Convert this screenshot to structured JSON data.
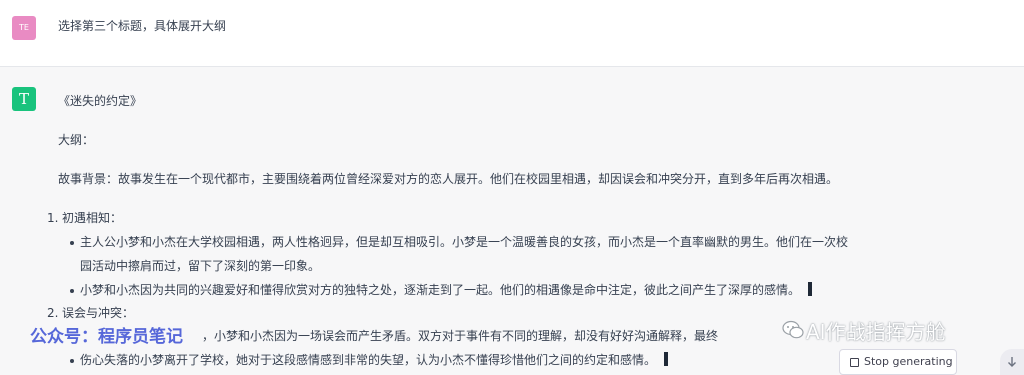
{
  "user_message": {
    "avatar_initials": "TE",
    "text": "选择第三个标题，具体展开大纲"
  },
  "assistant_message": {
    "avatar_letter": "T",
    "title": "《迷失的约定》",
    "outline_label": "大纲：",
    "background": "故事背景：故事发生在一个现代都市，主要围绕着两位曾经深爱对方的恋人展开。他们在校园里相遇，却因误会和冲突分开，直到多年后再次相遇。",
    "sections": [
      {
        "number": "1.",
        "heading": "初遇相知：",
        "bullets": [
          {
            "line1": "主人公小梦和小杰在大学校园相遇，两人性格迥异，但是却互相吸引。小梦是一个温暖善良的女孩，而小杰是一个直率幽默的男生。他们在一次校",
            "line2": "园活动中擦肩而过，留下了深刻的第一印象。"
          },
          {
            "line1": "小梦和小杰因为共同的兴趣爱好和懂得欣赏对方的独特之处，逐渐走到了一起。他们的相遇像是命中注定，彼此之间产生了深厚的感情。"
          }
        ]
      },
      {
        "number": "2.",
        "heading": "误会与冲突：",
        "bullets": [
          {
            "line1": "，小梦和小杰因为一场误会而产生矛盾。双方对于事件有不同的理解，却没有好好沟通解释，最终"
          },
          {
            "line1": "伤心失落的小梦离开了学校，她对于这段感情感到非常的失望，认为小杰不懂得珍惜他们之间的约定和感情。"
          }
        ]
      }
    ]
  },
  "watermarks": {
    "left": "公众号：程序员笔记",
    "right": "AI作战指挥方舱"
  },
  "controls": {
    "stop_generating": "Stop generating"
  },
  "colors": {
    "user_avatar": "#e98bc3",
    "assistant_avatar": "#19c37d",
    "watermark_left": "#3a4fd4"
  }
}
